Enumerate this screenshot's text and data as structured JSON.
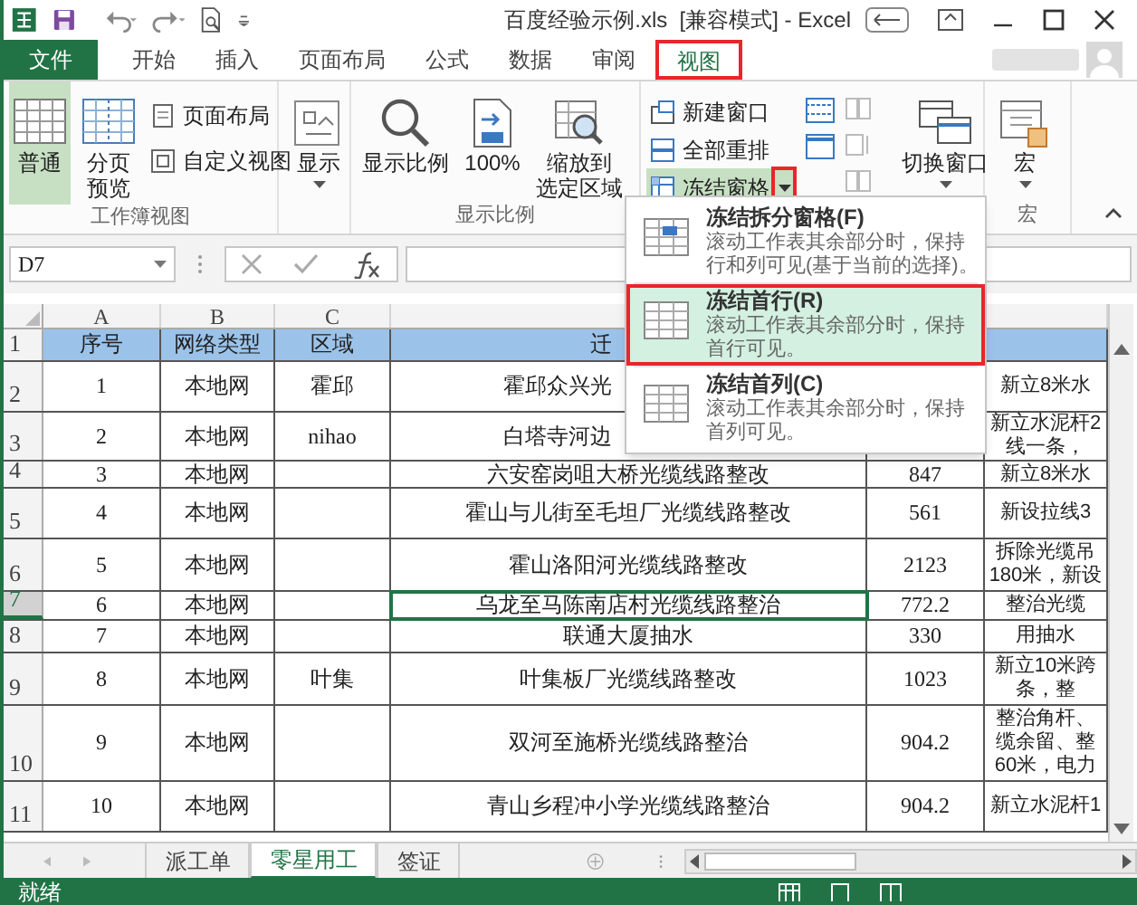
{
  "window": {
    "title": "百度经验示例.xls  [兼容模式] - Excel"
  },
  "ribbon_tabs": [
    {
      "label": "文件",
      "kind": "file",
      "selected": false,
      "annotated": false
    },
    {
      "label": "开始",
      "kind": "tab",
      "selected": false,
      "annotated": false
    },
    {
      "label": "插入",
      "kind": "tab",
      "selected": false,
      "annotated": false
    },
    {
      "label": "页面布局",
      "kind": "tab",
      "selected": false,
      "annotated": false
    },
    {
      "label": "公式",
      "kind": "tab",
      "selected": false,
      "annotated": false
    },
    {
      "label": "数据",
      "kind": "tab",
      "selected": false,
      "annotated": false
    },
    {
      "label": "审阅",
      "kind": "tab",
      "selected": false,
      "annotated": false
    },
    {
      "label": "视图",
      "kind": "tab",
      "selected": true,
      "annotated": true
    }
  ],
  "ribbon_groups": [
    {
      "label": "工作簿视图",
      "buttons": [
        {
          "label": "普通",
          "kind": "large",
          "selected": true
        },
        {
          "label": [
            "分页",
            "预览"
          ],
          "kind": "large",
          "selected": false
        },
        {
          "label": "页面布局",
          "kind": "small",
          "selected": false
        },
        {
          "label": "自定义视图",
          "kind": "small",
          "selected": false
        }
      ]
    },
    {
      "buttons": [
        {
          "label": "显示",
          "kind": "dropdown",
          "selected": false
        }
      ]
    },
    {
      "label": "显示比例",
      "buttons": [
        {
          "label": "显示比例",
          "kind": "large",
          "selected": false
        },
        {
          "label": "100%",
          "kind": "large",
          "selected": false
        },
        {
          "label": [
            "缩放到",
            "选定区域"
          ],
          "kind": "large",
          "selected": false
        }
      ]
    },
    {
      "buttons": [
        {
          "label": "新建窗口",
          "kind": "small",
          "selected": false
        },
        {
          "label": "全部重排",
          "kind": "small",
          "selected": false
        },
        {
          "label": "冻结窗格",
          "kind": "split",
          "selected": true
        },
        {
          "label": "切换窗口",
          "kind": "dropdown",
          "selected": false
        }
      ]
    },
    {
      "label": "宏",
      "buttons": [
        {
          "label": "宏",
          "kind": "dropdown",
          "selected": false
        }
      ]
    }
  ],
  "freeze_menu": {
    "arrow_annotated": true,
    "items": [
      {
        "title": "冻结拆分窗格(F)",
        "description": [
          "滚动工作表其余部分时，保持",
          "行和列可见(基于当前的选择)。"
        ],
        "selected": false,
        "annotated": false
      },
      {
        "title": "冻结首行(R)",
        "description": [
          "滚动工作表其余部分时，保持",
          "首行可见。"
        ],
        "selected": true,
        "annotated": true
      },
      {
        "title": "冻结首列(C)",
        "description": [
          "滚动工作表其余部分时，保持",
          "首列可见。"
        ],
        "selected": false,
        "annotated": false
      }
    ]
  },
  "formula_bar": {
    "name_box": "D7"
  },
  "sheet": {
    "columns": [
      "A",
      "B",
      "C"
    ],
    "rows": [
      {
        "number": "1",
        "kind": "header",
        "selected": false,
        "a": "序号",
        "b": "网络类型",
        "c": "区域",
        "d": "迁"
      },
      {
        "number": "2",
        "selected": false,
        "a": "1",
        "b": "本地网",
        "c": "霍邱",
        "d": "霍邱众兴光",
        "f": "新立8米水"
      },
      {
        "number": "3",
        "selected": false,
        "a": "2",
        "b": "本地网",
        "c": "nihao",
        "d": "白塔寺河边",
        "f": [
          "新立水泥杆2",
          "线一条，"
        ]
      },
      {
        "number": "4",
        "selected": false,
        "a": "3",
        "b": "本地网",
        "d": "六安窑岗咀大桥光缆线路整改",
        "e": "847",
        "f": "新立8米水"
      },
      {
        "number": "5",
        "selected": false,
        "a": "4",
        "b": "本地网",
        "d": "霍山与儿街至毛坦厂光缆线路整改",
        "e": "561",
        "f": "新设拉线3"
      },
      {
        "number": "6",
        "selected": false,
        "a": "5",
        "b": "本地网",
        "d": "霍山洛阳河光缆线路整改",
        "e": "2123",
        "f": [
          "拆除光缆吊",
          "180米，新设"
        ]
      },
      {
        "number": "7",
        "selected": true,
        "a": "6",
        "b": "本地网",
        "d": "乌龙至马陈南店村光缆线路整治",
        "e": "772.2",
        "f": "整治光缆"
      },
      {
        "number": "8",
        "selected": false,
        "a": "7",
        "b": "本地网",
        "d": "联通大厦抽水",
        "e": "330",
        "f": "用抽水"
      },
      {
        "number": "9",
        "selected": false,
        "a": "8",
        "b": "本地网",
        "c": "叶集",
        "d": "叶集板厂光缆线路整改",
        "e": "1023",
        "f": [
          "新立10米跨",
          "条，整"
        ]
      },
      {
        "number": "10",
        "selected": false,
        "a": "9",
        "b": "本地网",
        "d": "双河至施桥光缆线路整治",
        "e": "904.2",
        "f": [
          "整治角杆、",
          "缆余留、整",
          "60米，电力"
        ]
      },
      {
        "number": "11",
        "selected": false,
        "a": "10",
        "b": "本地网",
        "d": "青山乡程冲小学光缆线路整治",
        "e": "904.2",
        "f": "新立水泥杆1"
      }
    ]
  },
  "sheet_tabs": [
    {
      "label": "派工单",
      "selected": false
    },
    {
      "label": "零星用工",
      "selected": true
    },
    {
      "label": "签证",
      "selected": false
    }
  ],
  "status_bar": {
    "text": "就绪"
  }
}
